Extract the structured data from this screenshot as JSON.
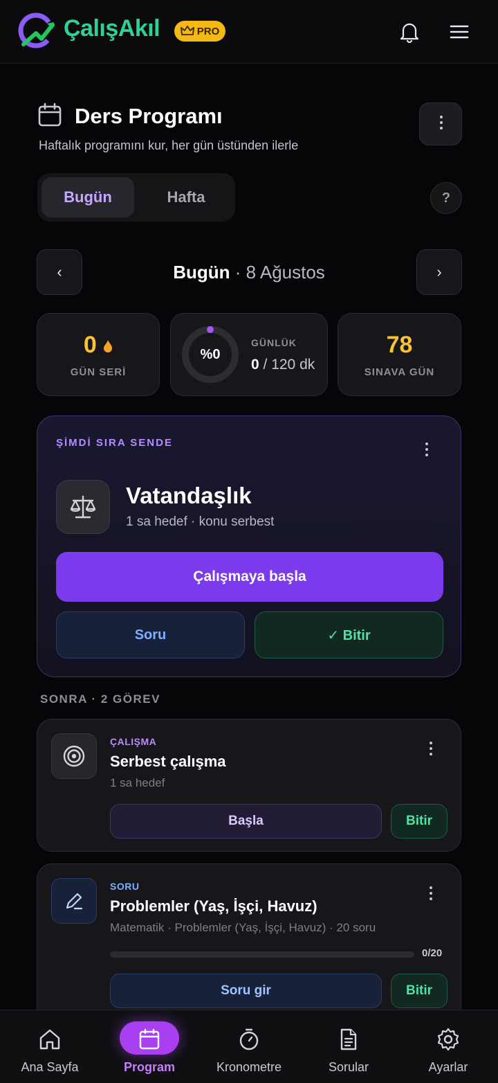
{
  "header": {
    "brand": "ÇalışAkıl",
    "badge": "PRO",
    "icons": {
      "notifications": "bell-icon",
      "menu": "hamburger-icon"
    }
  },
  "page": {
    "title": "Ders Programı",
    "subtitle": "Haftalık programını kur, her gün üstünden ilerle",
    "tabs": [
      {
        "label": "Bugün",
        "active": true
      },
      {
        "label": "Hafta",
        "active": false
      }
    ],
    "help": "?"
  },
  "date_nav": {
    "prev": "‹",
    "next": "›",
    "today": "Bugün",
    "date": " · 8 Ağustos"
  },
  "stats": {
    "streak": {
      "value": "0",
      "label": "GÜN SERİ"
    },
    "daily": {
      "percent": "%0",
      "percent_value": 0,
      "label": "GÜNLÜK",
      "done": "0",
      "target": " / 120 dk"
    },
    "exam": {
      "value": "78",
      "label": "SINAVA GÜN"
    }
  },
  "now": {
    "tag": "ŞİMDİ SIRA SENDE",
    "subject": "Vatandaşlık",
    "detail": "1 sa hedef · konu serbest",
    "start": "Çalışmaya başla",
    "question": "Soru",
    "finish": "✓ Bitir"
  },
  "later": {
    "heading": "SONRA · 2 GÖREV",
    "tasks": [
      {
        "kind": "ÇALIŞMA",
        "title": "Serbest çalışma",
        "sub": "1 sa hedef",
        "action": "Başla",
        "finish": "Bitir"
      },
      {
        "kind": "SORU",
        "title": "Problemler (Yaş, İşçi, Havuz)",
        "sub": "Matematik · Problemler (Yaş, İşçi, Havuz) · 20 soru",
        "progress_text": "0/20",
        "progress_value": 0,
        "action": "Soru gir",
        "finish": "Bitir"
      }
    ]
  },
  "bottom_nav": [
    {
      "label": "Ana Sayfa",
      "icon": "home-icon"
    },
    {
      "label": "Program",
      "icon": "calendar-icon",
      "active": true
    },
    {
      "label": "Kronometre",
      "icon": "stopwatch-icon"
    },
    {
      "label": "Sorular",
      "icon": "document-icon"
    },
    {
      "label": "Ayarlar",
      "icon": "gear-icon"
    }
  ],
  "colors": {
    "accent": "#7c3aed",
    "brand": "#2fd199",
    "pro": "#f5b915",
    "stat_value": "#f7c233",
    "success": "#4fe3a6",
    "info": "#7fb0ff"
  }
}
